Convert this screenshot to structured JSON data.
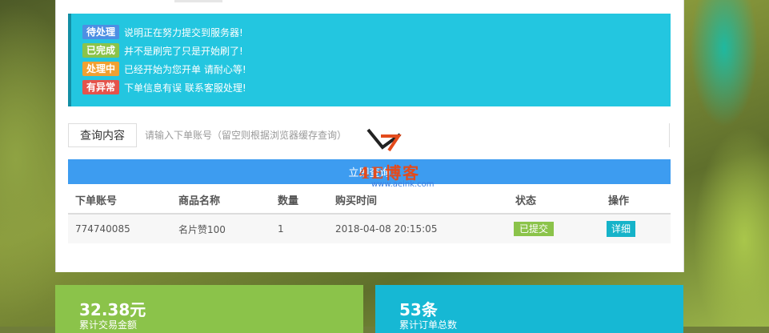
{
  "notices": [
    {
      "badge": "待处理",
      "color": "#4d8fe3",
      "text": "说明正在努力提交到服务器!"
    },
    {
      "badge": "已完成",
      "color": "#8bc34a",
      "text": "并不是刷完了只是开始刷了!"
    },
    {
      "badge": "处理中",
      "color": "#f0a131",
      "text": "已经开始为您开单 请耐心等!"
    },
    {
      "badge": "有异常",
      "color": "#e5534b",
      "text": "下单信息有误 联系客服处理!"
    }
  ],
  "query": {
    "label": "查询内容",
    "placeholder": "请输入下单账号（留空则根据浏览器缓存查询）",
    "button": "立即查询"
  },
  "table": {
    "headers": [
      "下单账号",
      "商品名称",
      "数量",
      "购买时间",
      "状态",
      "操作"
    ],
    "rows": [
      {
        "account": "774740085",
        "product": "名片赞100",
        "qty": "1",
        "time": "2018-04-08 20:15:05",
        "status": "已提交",
        "action": "详细"
      }
    ]
  },
  "watermark": {
    "text": "4E博客",
    "url": "www.aeink.com"
  },
  "stats": [
    {
      "value": "32.38元",
      "label": "累计交易金额",
      "color": "#8bc34a"
    },
    {
      "value": "53条",
      "label": "累计订单总数",
      "color": "#16b8d4"
    }
  ]
}
